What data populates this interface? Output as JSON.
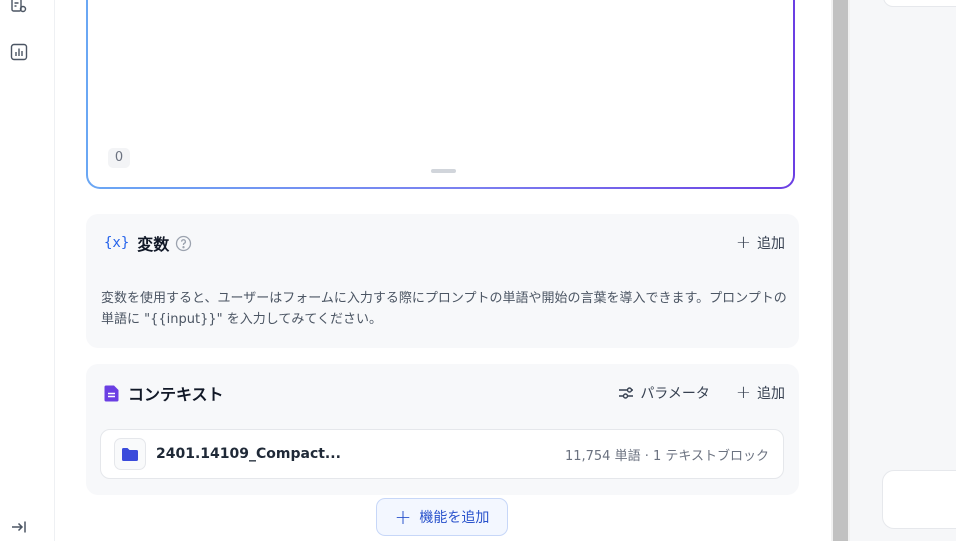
{
  "sidebar": {
    "icons": [
      "settings-list-icon",
      "chart-icon"
    ],
    "collapse_icon": "expand-right-icon"
  },
  "prompt": {
    "char_count": "0"
  },
  "variables": {
    "icon": "{x}",
    "title": "変数",
    "add_label": "追加",
    "description": "変数を使用すると、ユーザーはフォームに入力する際にプロンプトの単語や開始の言葉を導入できます。プロンプトの単語に \"{{input}}\" を入力してみてください。"
  },
  "context": {
    "title": "コンテキスト",
    "params_label": "パラメータ",
    "add_label": "追加",
    "file": {
      "name": "2401.14109_Compact...",
      "meta": "11,754 単語 · 1 テキストブロック"
    }
  },
  "add_feature_label": "機能を追加",
  "colors": {
    "accent_blue": "#2952cc",
    "purple": "#6b3fe3",
    "card_bg": "#f7f8fa"
  }
}
